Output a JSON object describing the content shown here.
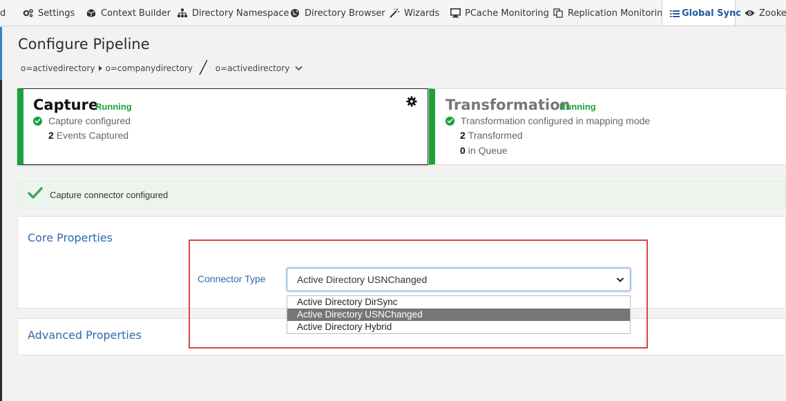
{
  "tabs": [
    {
      "label": "d",
      "icon": ""
    },
    {
      "label": "Settings",
      "icon": "gears-icon"
    },
    {
      "label": "Context Builder",
      "icon": "cube-icon"
    },
    {
      "label": "Directory Namespace",
      "icon": "sitemap-icon"
    },
    {
      "label": "Directory Browser",
      "icon": "globe-icon"
    },
    {
      "label": "Wizards",
      "icon": "magic-wand-icon"
    },
    {
      "label": "PCache Monitoring",
      "icon": "monitor-icon"
    },
    {
      "label": "Replication Monitoring",
      "icon": "copy-icon"
    },
    {
      "label": "Global Sync",
      "icon": "list-icon",
      "active": true
    },
    {
      "label": "Zookee",
      "icon": "eye-icon"
    }
  ],
  "page_title": "Configure Pipeline",
  "breadcrumb": {
    "source_parent": "o=activedirectory",
    "source_child": "o=companydirectory",
    "target": "o=activedirectory"
  },
  "capture": {
    "title": "Capture",
    "status": "Running",
    "line1": "Capture configured",
    "count": "2",
    "count_label": "Events Captured"
  },
  "transformation": {
    "title": "Transformation",
    "status": "Running",
    "line1": "Transformation configured in mapping mode",
    "transformed_count": "2",
    "transformed_label": "Transformed",
    "queue_count": "0",
    "queue_label": "in Queue"
  },
  "notice": "Capture connector configured",
  "core_properties": {
    "heading": "Core Properties",
    "connector_label": "Connector Type",
    "selected": "Active Directory USNChanged",
    "options": [
      "Active Directory DirSync",
      "Active Directory USNChanged",
      "Active Directory Hybrid"
    ]
  },
  "advanced_properties": {
    "heading": "Advanced Properties"
  },
  "colors": {
    "running": "#1aa13c",
    "accent": "#2e6aa8",
    "highlight": "#d9443f"
  }
}
